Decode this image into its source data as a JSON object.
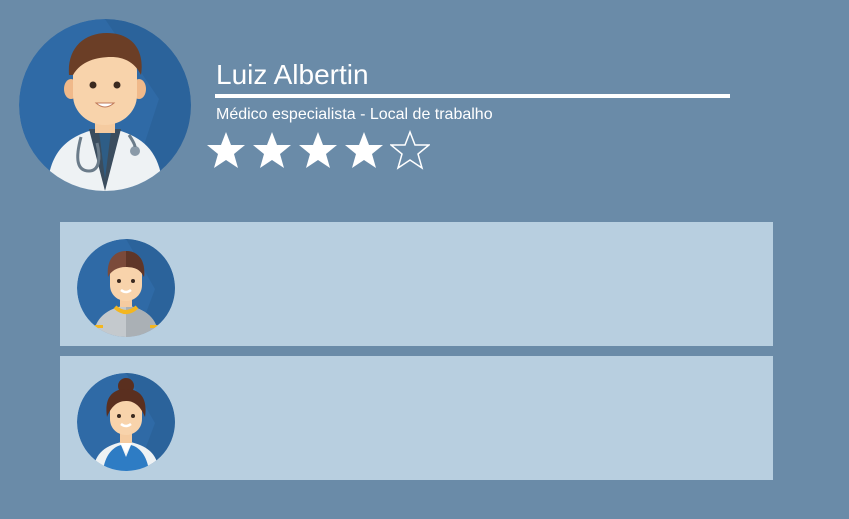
{
  "profile": {
    "name": "Luiz Albertin",
    "subtitle": "Médico especialista - Local de trabalho",
    "avatar_icon": "doctor-avatar-icon",
    "rating": {
      "value": 4,
      "max": 5,
      "filled_icon": "star-filled-icon",
      "empty_icon": "star-outline-icon"
    }
  },
  "reviews": [
    {
      "avatar_icon": "man-avatar-icon"
    },
    {
      "avatar_icon": "woman-avatar-icon"
    }
  ],
  "colors": {
    "background": "#6a8ba8",
    "card": "#b8cfe0",
    "avatar_circle": "#2f6aa6",
    "text": "#ffffff"
  }
}
